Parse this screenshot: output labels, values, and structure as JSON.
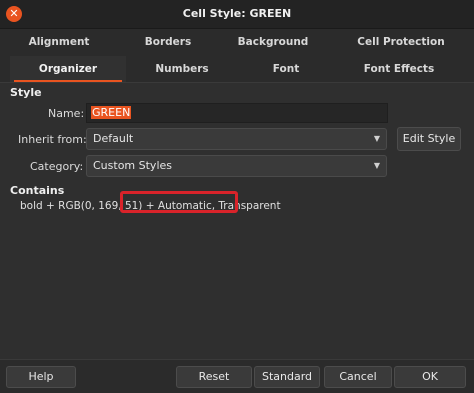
{
  "window": {
    "title": "Cell Style: GREEN"
  },
  "tabs_row1": [
    "Alignment",
    "Borders",
    "Background",
    "Cell Protection"
  ],
  "tabs_row2": [
    "Organizer",
    "Numbers",
    "Font",
    "Font Effects"
  ],
  "active_tab": "Organizer",
  "style_section": {
    "heading": "Style",
    "name_label": "Name:",
    "name_value": "GREEN",
    "inherit_label": "Inherit from:",
    "inherit_value": "Default",
    "edit_style_label": "Edit Style",
    "category_label": "Category:",
    "category_value": "Custom Styles"
  },
  "contains_section": {
    "heading": "Contains",
    "prefix": "bold + RGB(0, 169, 51) + ",
    "highlighted": "Automatic, Transparent"
  },
  "buttons": {
    "help": "Help",
    "reset": "Reset",
    "standard": "Standard",
    "cancel": "Cancel",
    "ok": "OK"
  },
  "colors": {
    "accent": "#e95420",
    "highlight_border": "#d9232a",
    "panel_bg": "#2f2f2f"
  }
}
